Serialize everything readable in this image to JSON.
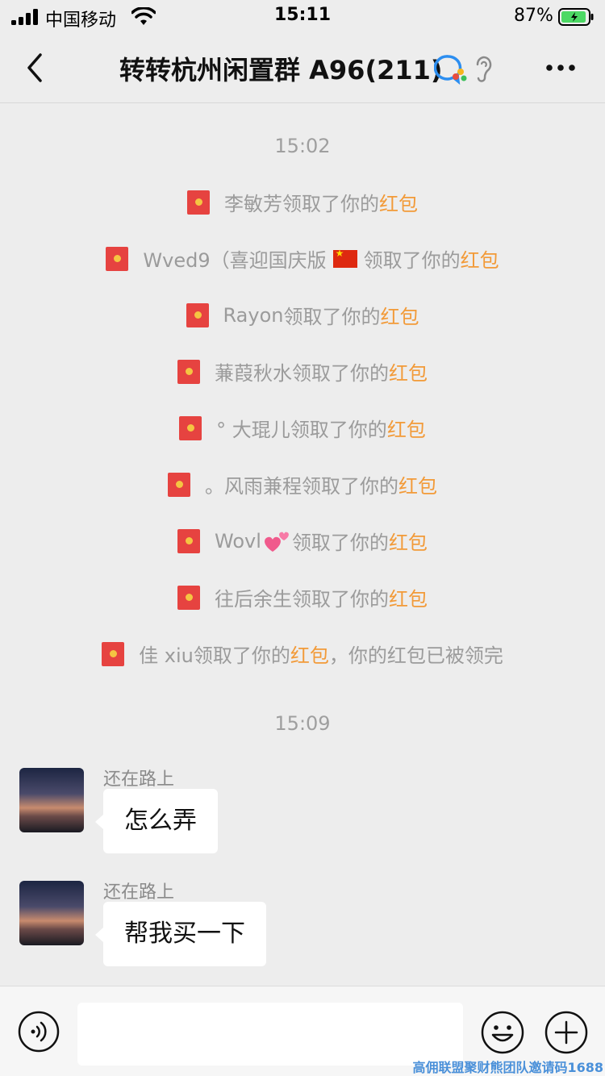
{
  "status_bar": {
    "carrier": "中国移动",
    "time": "15:11",
    "battery_pct": "87%"
  },
  "nav": {
    "title": "转转杭州闲置群 A96(211)"
  },
  "messages": {
    "time1": "15:02",
    "notices": [
      {
        "name": "李敏芳",
        "action": "领取了你的",
        "link": "红包"
      },
      {
        "name": "Wved9（喜迎国庆版",
        "action": "领取了你的",
        "link": "红包"
      },
      {
        "name": "Rayon",
        "action": "领取了你的",
        "link": "红包"
      },
      {
        "name": "蒹葭秋水",
        "action": "领取了你的",
        "link": "红包"
      },
      {
        "name": "°  大琨儿",
        "action": "领取了你的",
        "link": "红包"
      },
      {
        "name": "。风雨兼程",
        "action": "领取了你的",
        "link": "红包"
      },
      {
        "name": "Wovl",
        "action": "领取了你的",
        "link": "红包"
      },
      {
        "name": "往后余生",
        "action": "领取了你的",
        "link": "红包"
      },
      {
        "name": "佳 xiu",
        "action": "领取了你的",
        "link": "红包",
        "suffix": "，你的红包已被领完"
      }
    ],
    "time2": "15:09",
    "chats": [
      {
        "sender": "还在路上",
        "text": "怎么弄"
      },
      {
        "sender": "还在路上",
        "text": "帮我买一下"
      }
    ]
  },
  "icons": {
    "notice_icon": "red-packet-icon",
    "back": "chevron-left-icon",
    "more": "more-dots-icon",
    "voice": "voice-icon",
    "emoji": "emoji-icon",
    "plus": "plus-icon"
  },
  "colors": {
    "background": "#ededed",
    "highlight": "#f29a38",
    "red_packet": "#e64340",
    "battery_green": "#4cd964"
  },
  "watermark": "高佣联盟聚财熊团队邀请码1688"
}
